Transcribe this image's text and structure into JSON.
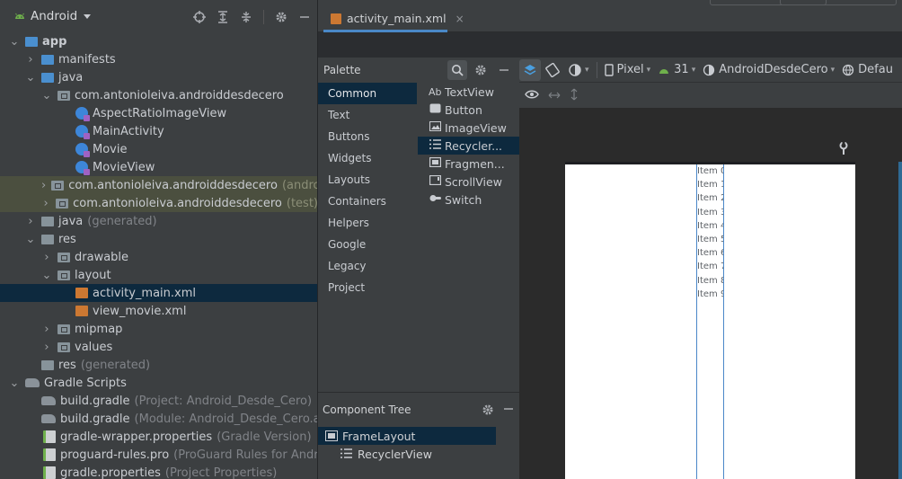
{
  "project": {
    "view_title": "Android",
    "tree": [
      {
        "label": "app",
        "hint": ""
      },
      {
        "label": "manifests",
        "hint": ""
      },
      {
        "label": "java",
        "hint": ""
      },
      {
        "label": "com.antonioleiva.androiddesdecero",
        "hint": ""
      },
      {
        "label": "AspectRatioImageView",
        "hint": ""
      },
      {
        "label": "MainActivity",
        "hint": ""
      },
      {
        "label": "Movie",
        "hint": ""
      },
      {
        "label": "MovieView",
        "hint": ""
      },
      {
        "label": "com.antonioleiva.androiddesdecero",
        "hint": "(androic"
      },
      {
        "label": "com.antonioleiva.androiddesdecero",
        "hint": "(test)"
      },
      {
        "label": "java",
        "hint": "(generated)"
      },
      {
        "label": "res",
        "hint": ""
      },
      {
        "label": "drawable",
        "hint": ""
      },
      {
        "label": "layout",
        "hint": ""
      },
      {
        "label": "activity_main.xml",
        "hint": ""
      },
      {
        "label": "view_movie.xml",
        "hint": ""
      },
      {
        "label": "mipmap",
        "hint": ""
      },
      {
        "label": "values",
        "hint": ""
      },
      {
        "label": "res",
        "hint": "(generated)"
      },
      {
        "label": "Gradle Scripts",
        "hint": ""
      },
      {
        "label": "build.gradle",
        "hint": "(Project: Android_Desde_Cero)"
      },
      {
        "label": "build.gradle",
        "hint": "(Module: Android_Desde_Cero.app"
      },
      {
        "label": "gradle-wrapper.properties",
        "hint": "(Gradle Version)"
      },
      {
        "label": "proguard-rules.pro",
        "hint": "(ProGuard Rules for Androi"
      },
      {
        "label": "gradle.properties",
        "hint": "(Project Properties)"
      }
    ]
  },
  "editor": {
    "tab_label": "activity_main.xml",
    "tab_close": "×"
  },
  "palette": {
    "title": "Palette",
    "categories": [
      "Common",
      "Text",
      "Buttons",
      "Widgets",
      "Layouts",
      "Containers",
      "Helpers",
      "Google",
      "Legacy",
      "Project"
    ],
    "widgets": [
      {
        "icon": "Ab",
        "label": "TextView"
      },
      {
        "icon": "",
        "label": "Button"
      },
      {
        "icon": "",
        "label": "ImageView"
      },
      {
        "icon": "",
        "label": "Recycler..."
      },
      {
        "icon": "",
        "label": "Fragmen..."
      },
      {
        "icon": "",
        "label": "ScrollView"
      },
      {
        "icon": "",
        "label": "Switch"
      }
    ]
  },
  "component_tree": {
    "title": "Component Tree",
    "items": [
      "FrameLayout",
      "RecyclerView"
    ]
  },
  "design_toolbar": {
    "device": "Pixel",
    "api": "31",
    "theme": "AndroidDesdeCero",
    "locale": "Defau"
  },
  "preview": {
    "items": [
      "Item 0",
      "Item 1",
      "Item 2",
      "Item 3",
      "Item 4",
      "Item 5",
      "Item 6",
      "Item 7",
      "Item 8",
      "Item 9"
    ]
  }
}
